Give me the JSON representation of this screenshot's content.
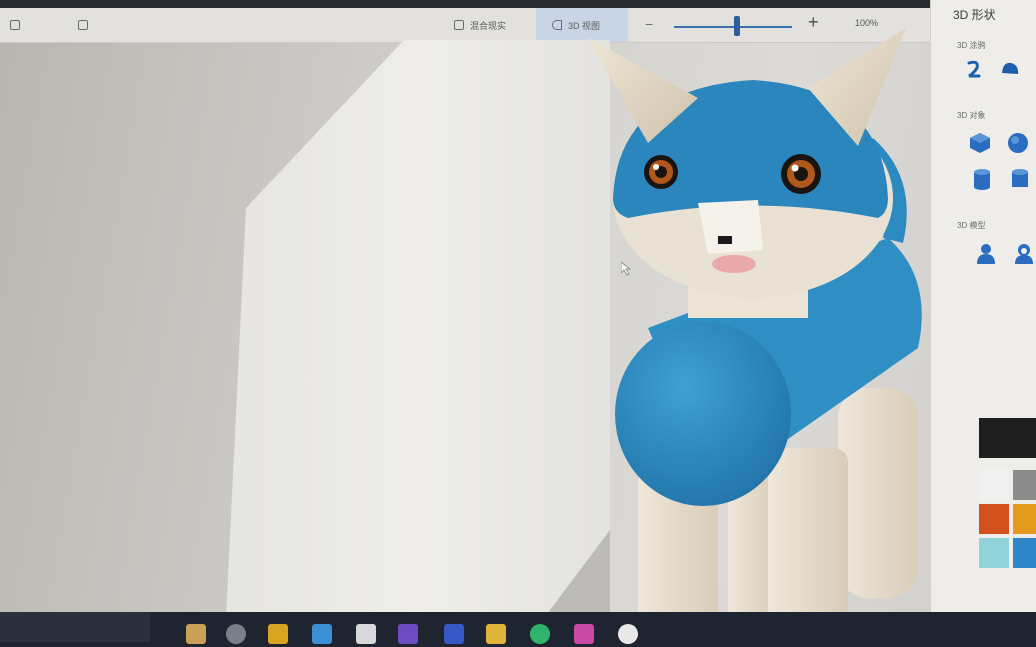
{
  "app": {
    "toolbar": {
      "mixed_reality_label": "混合现实",
      "view_3d_label": "3D 视图",
      "zoom_percent": "100%",
      "zoom_minus": "−",
      "zoom_plus": "+"
    },
    "panel": {
      "title": "3D 形状",
      "sections": [
        {
          "label": "3D 涂鸦"
        },
        {
          "label": "3D 对象"
        },
        {
          "label": "3D 模型"
        }
      ]
    },
    "colors": {
      "swatches": [
        "#1e1e1e",
        "#f0f0f0",
        "#8c8c8c",
        "#d4501e",
        "#e39a1c",
        "#8fd3d8",
        "#2e85c7"
      ],
      "cat_blue": "#2f8ec4",
      "cat_cream": "#e8dfd0"
    }
  }
}
